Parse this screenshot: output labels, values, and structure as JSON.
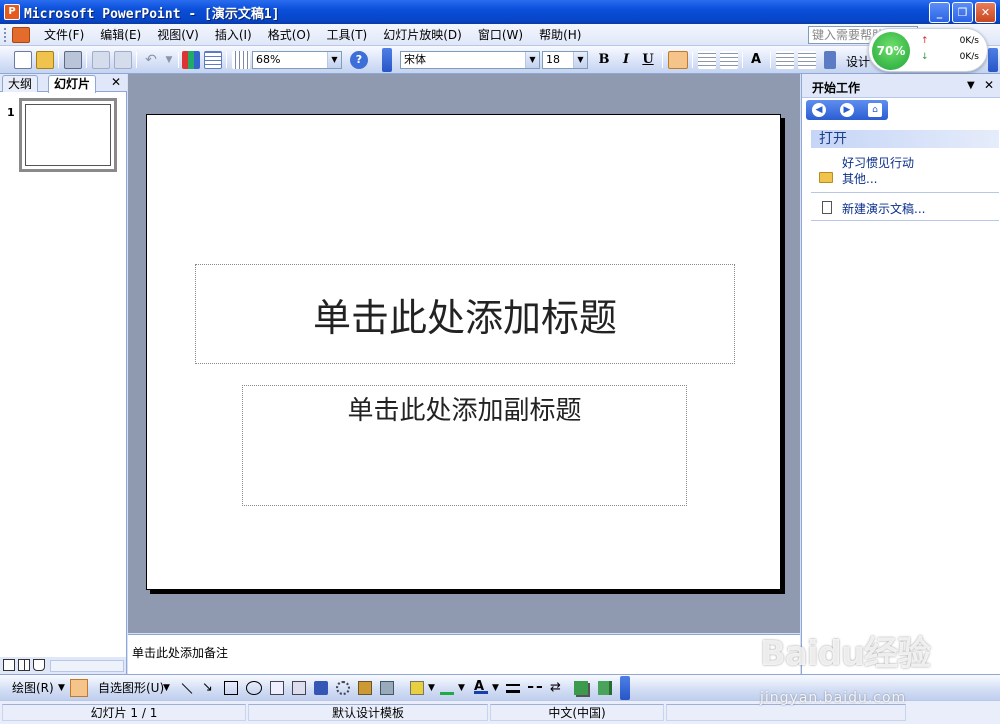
{
  "window": {
    "title": "Microsoft PowerPoint - [演示文稿1]",
    "app_icon": "powerpoint-icon",
    "min_label": "_",
    "restore_label": "❐",
    "close_label": "✕"
  },
  "menu": {
    "items": [
      "文件(F)",
      "编辑(E)",
      "视图(V)",
      "插入(I)",
      "格式(O)",
      "工具(T)",
      "幻灯片放映(D)",
      "窗口(W)",
      "帮助(H)"
    ],
    "help_placeholder": "键入需要帮助"
  },
  "toolbar": {
    "zoom": "68%",
    "font_name": "宋体",
    "font_size": "18",
    "bold": "B",
    "italic": "I",
    "underline": "U",
    "design_label": "设计"
  },
  "speed_widget": {
    "percent": "70%",
    "upload": "0K/s",
    "download": "0K/s"
  },
  "left_pane": {
    "tabs": [
      "大纲",
      "幻灯片"
    ],
    "close": "✕",
    "slide_number": "1"
  },
  "slide": {
    "title_placeholder": "单击此处添加标题",
    "subtitle_placeholder": "单击此处添加副标题"
  },
  "notes": {
    "placeholder": "单击此处添加备注"
  },
  "task_pane": {
    "title": "开始工作",
    "dropdown": "▼",
    "close": "✕",
    "section": "打开",
    "recent_file": "好习惯见行动",
    "more": "其他...",
    "new_presentation": "新建演示文稿..."
  },
  "draw_toolbar": {
    "draw_label": "绘图(R)",
    "autoshapes_label": "自选图形(U)"
  },
  "status": {
    "slide_info": "幻灯片 1 / 1",
    "template": "默认设计模板",
    "language": "中文(中国)"
  },
  "watermark": {
    "logo": "Baidu经验",
    "url": "jingyan.baidu.com"
  },
  "colors": {
    "titlebar": "#0a4fd9",
    "workspace": "#8f9ab0",
    "accent": "#e36b2c"
  }
}
